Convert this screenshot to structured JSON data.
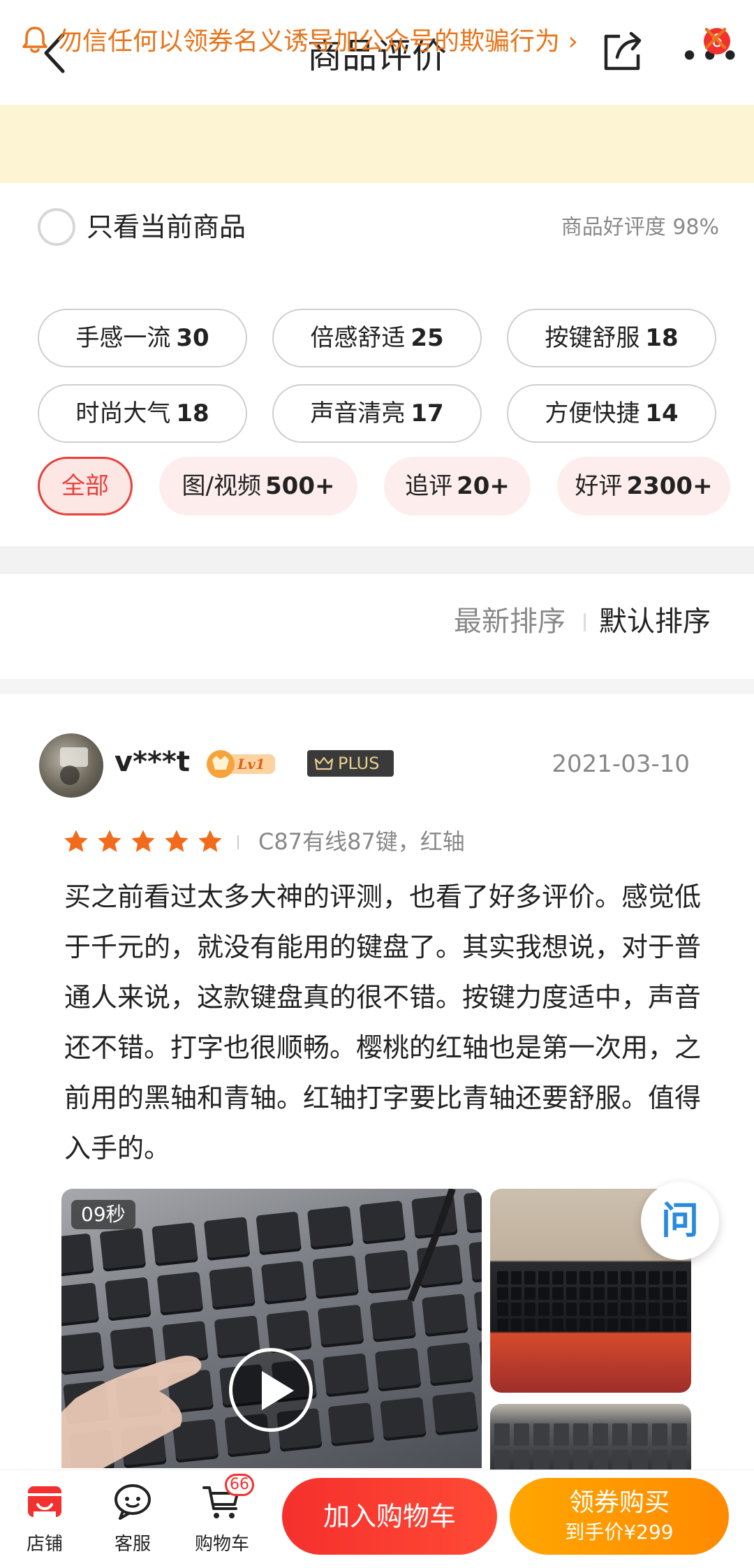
{
  "header": {
    "title": "商品评价",
    "more_badge": "6"
  },
  "notice": {
    "text": "勿信任何以领券名义诱导加公众号的欺骗行为"
  },
  "filter": {
    "only_current_label": "只看当前商品",
    "rating_summary": "商品好评度 98%",
    "tags": [
      {
        "label": "手感一流",
        "count": "30"
      },
      {
        "label": "倍感舒适",
        "count": "25"
      },
      {
        "label": "按键舒服",
        "count": "18"
      },
      {
        "label": "时尚大气",
        "count": "18"
      },
      {
        "label": "声音清亮",
        "count": "17"
      },
      {
        "label": "方便快捷",
        "count": "14"
      }
    ],
    "pills": [
      {
        "label": "全部",
        "count": ""
      },
      {
        "label": "图/视频",
        "count": "500+"
      },
      {
        "label": "追评",
        "count": "20+"
      },
      {
        "label": "好评",
        "count": "2300+"
      }
    ]
  },
  "sort": {
    "latest": "最新排序",
    "default": "默认排序"
  },
  "review": {
    "username": "v***t",
    "level": "Lv1",
    "plus": "PLUS",
    "date": "2021-03-10",
    "stars": 5,
    "spec": "C87有线87键，红轴",
    "text": "买之前看过太多大神的评测，也看了好多评价。感觉低于千元的，就没有能用的键盘了。其实我想说，对于普通人来说，这款键盘真的很不错。按键力度适中，声音还不错。打字也很顺畅。樱桃的红轴也是第一次用，之前用的黑轴和青轴。红轴打字要比青轴还要舒服。值得入手的。",
    "video_duration": "09秒",
    "ask_glyph": "问"
  },
  "bottom": {
    "shop_label": "店铺",
    "service_label": "客服",
    "cart_label": "购物车",
    "cart_badge": "66",
    "add_cart": "加入购物车",
    "buy_main": "领券购买",
    "buy_sub": "到手价¥299"
  },
  "colors": {
    "accent_red": "#e9403a",
    "notice_orange": "#e8741a",
    "star_orange": "#f26a1b",
    "buy_orange": "#ff9800"
  }
}
